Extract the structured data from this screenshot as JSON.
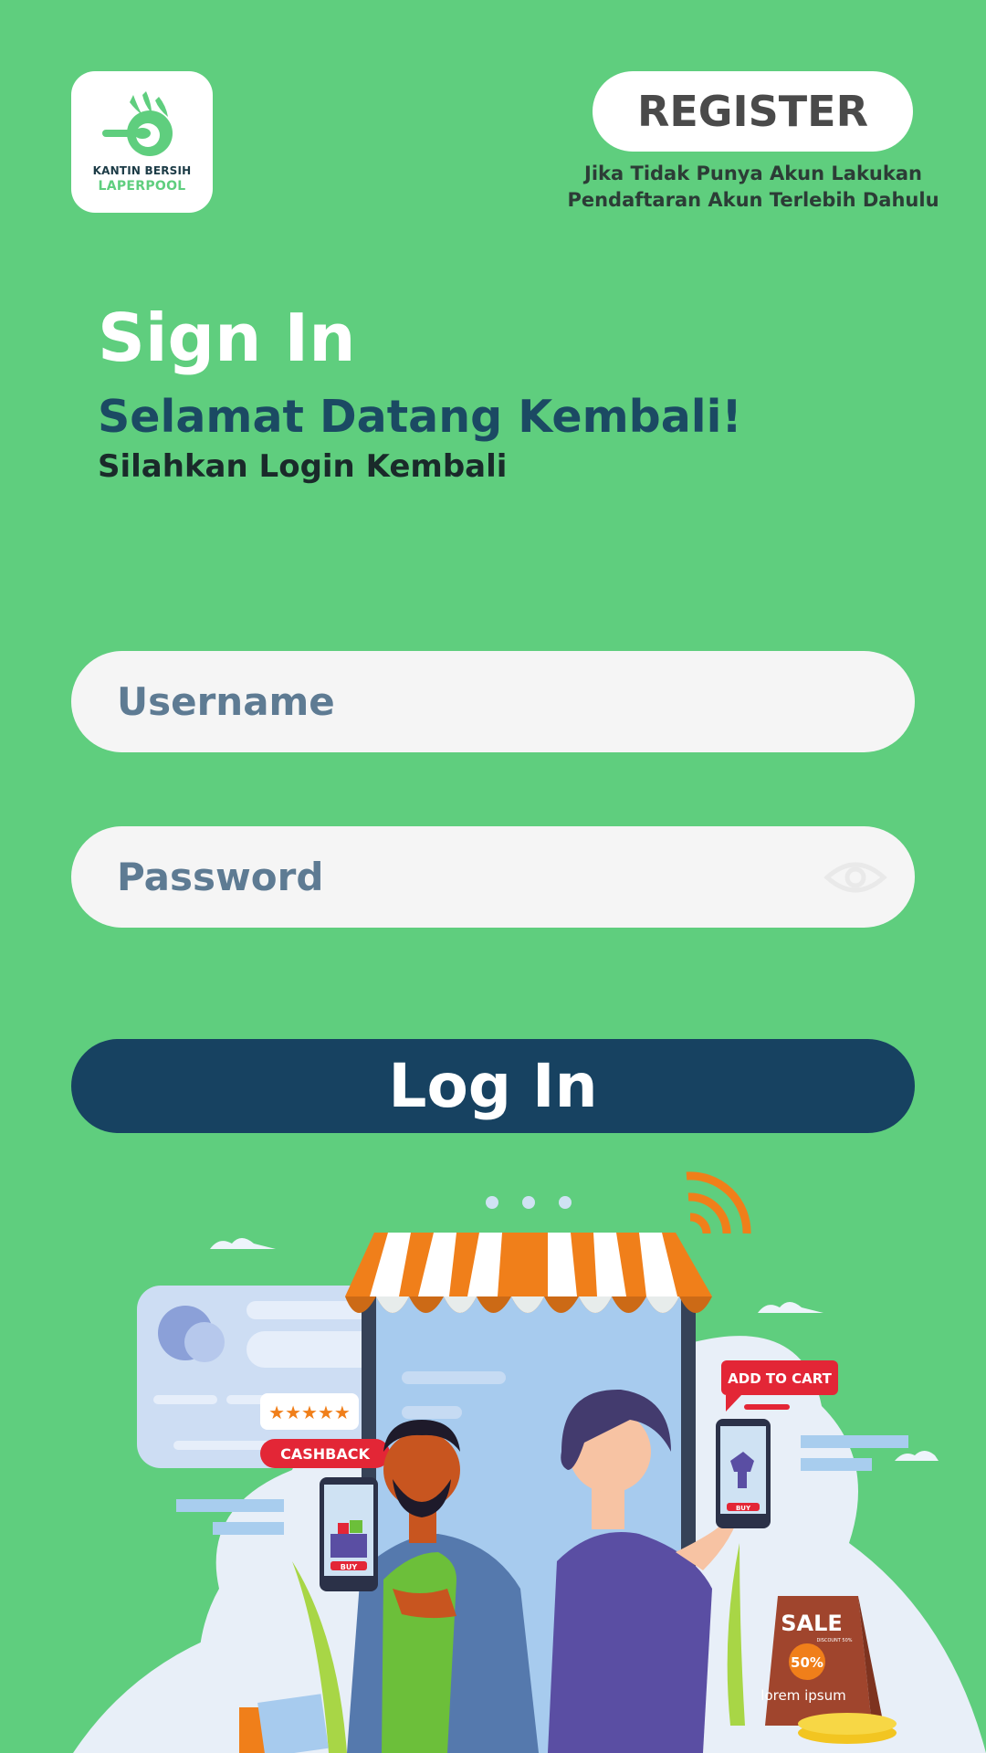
{
  "logo": {
    "line1": "KANTIN BERSIH",
    "line2": "LAPERPOOL"
  },
  "header": {
    "register_label": "REGISTER",
    "register_note": "Jika Tidak Punya Akun Lakukan Pendaftaran Akun Terlebih Dahulu"
  },
  "main": {
    "title": "Sign In",
    "welcome": "Selamat Datang Kembali!",
    "subtitle": "Silahkan Login Kembali"
  },
  "form": {
    "username_placeholder": "Username",
    "password_placeholder": "Password",
    "login_label": "Log In"
  },
  "illustration": {
    "cashback_label": "CASHBACK",
    "add_to_cart_label": "ADD TO CART",
    "buy_label": "BUY",
    "sale_label": "SALE",
    "discount_label": "DISCOUNT 50%",
    "percent_label": "50%",
    "lorem_label": "lorem ipsum",
    "rating_stars": "★★★★★"
  },
  "colors": {
    "background": "#5fce7e",
    "primary_dark": "#174261",
    "welcome_text": "#1b4a63",
    "field_bg": "#f5f5f5",
    "awning_orange": "#f07f1a"
  }
}
